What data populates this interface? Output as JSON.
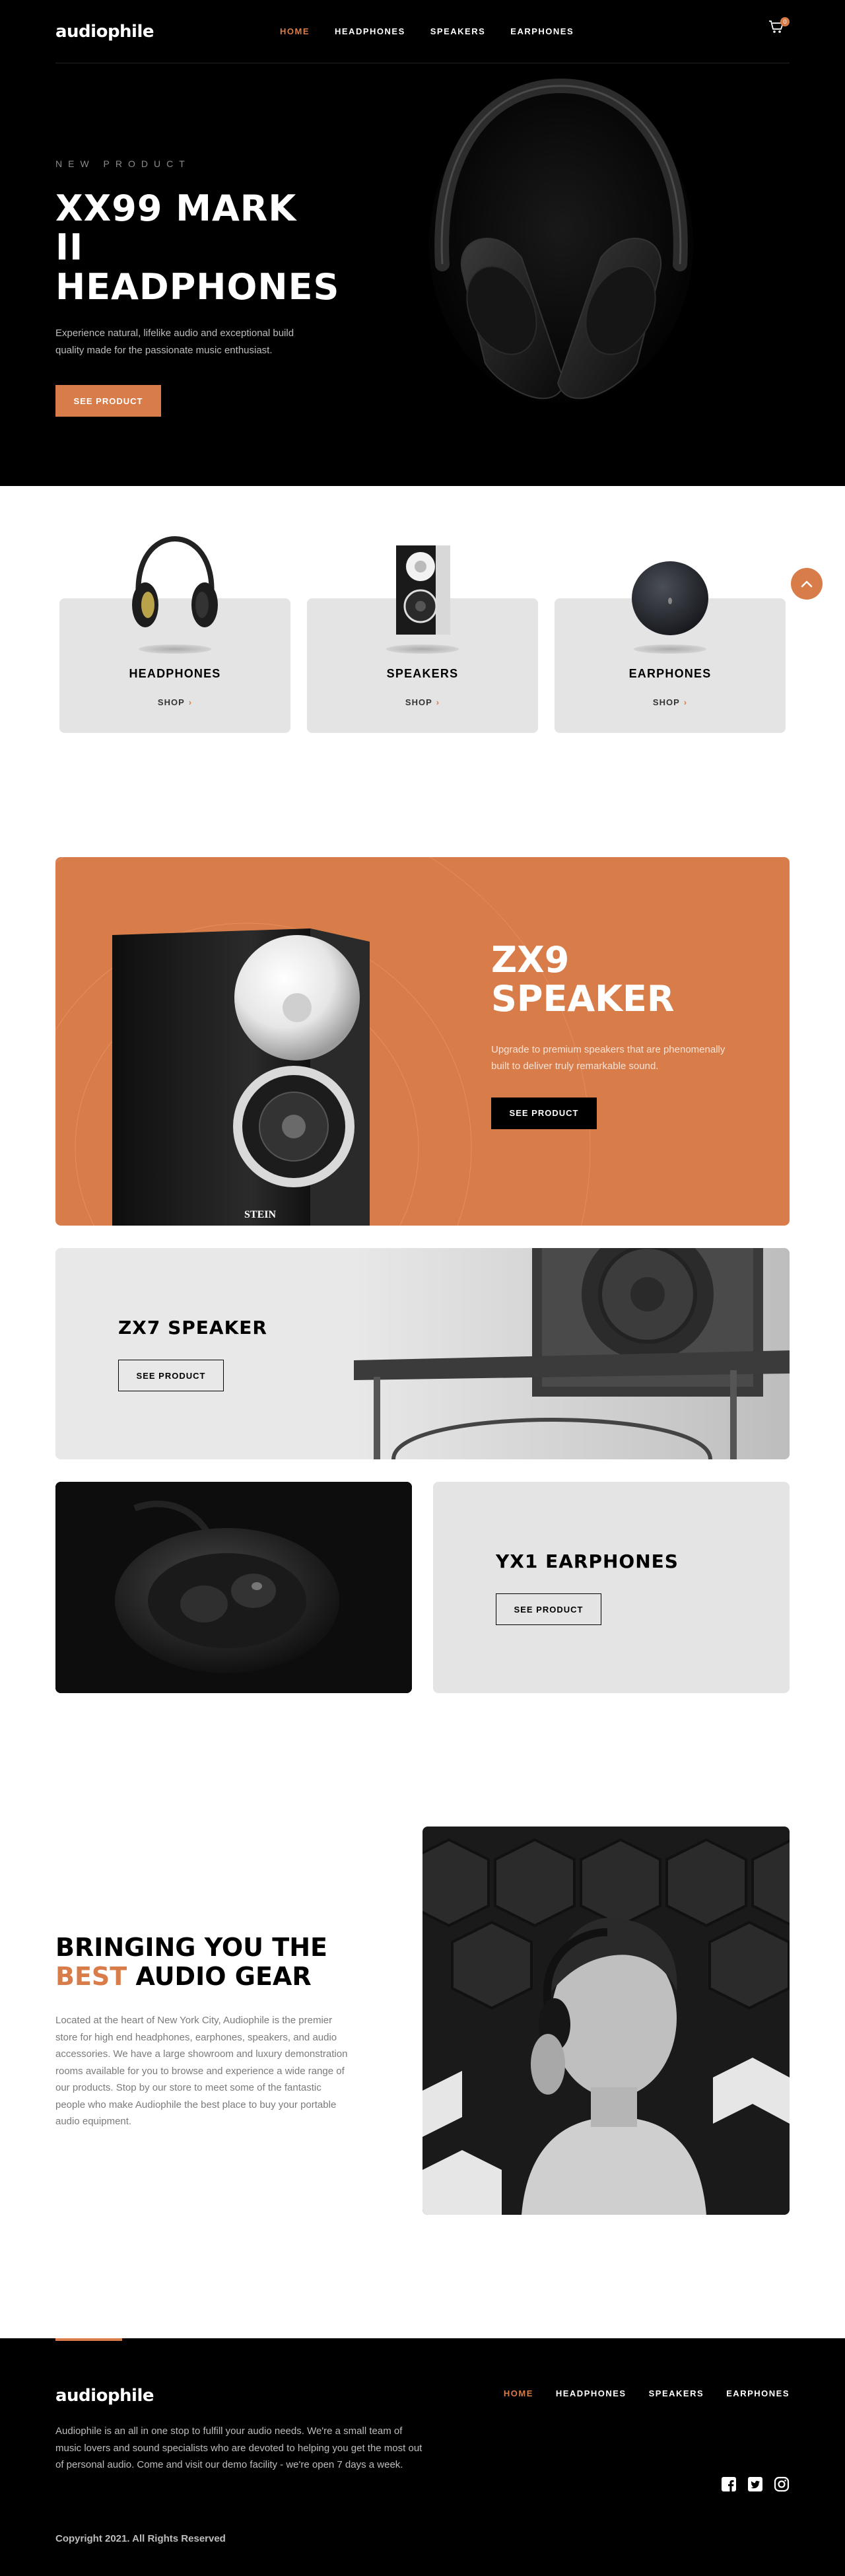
{
  "header": {
    "logo": "audiophile",
    "nav": [
      "HOME",
      "HEADPHONES",
      "SPEAKERS",
      "EARPHONES"
    ],
    "active_nav": "HOME",
    "cart_count": "0"
  },
  "hero": {
    "overline": "NEW PRODUCT",
    "title_line1": "XX99 MARK II",
    "title_line2": "HEADPHONES",
    "description": "Experience natural, lifelike audio and exceptional build quality made for the passionate music enthusiast.",
    "button": "SEE PRODUCT"
  },
  "categories": [
    {
      "title": "HEADPHONES",
      "link": "SHOP"
    },
    {
      "title": "SPEAKERS",
      "link": "SHOP"
    },
    {
      "title": "EARPHONES",
      "link": "SHOP"
    }
  ],
  "zx9": {
    "title_line1": "ZX9",
    "title_line2": "SPEAKER",
    "description": "Upgrade to premium speakers that are phenomenally built to deliver truly remarkable sound.",
    "button": "SEE PRODUCT",
    "brand": "STEIN"
  },
  "zx7": {
    "title": "ZX7 SPEAKER",
    "button": "SEE PRODUCT"
  },
  "yx1": {
    "title": "YX1 EARPHONES",
    "button": "SEE PRODUCT"
  },
  "about": {
    "title_part1": "BRINGING YOU THE",
    "title_accent": "BEST",
    "title_part2": "AUDIO GEAR",
    "description": "Located at the heart of New York City, Audiophile is the premier store for high end headphones, earphones, speakers, and audio accessories. We have a large showroom and luxury demonstration rooms available for you to browse and experience a wide range of our products. Stop by our store to meet some of the fantastic people who make Audiophile the best place to buy your portable audio equipment."
  },
  "footer": {
    "logo": "audiophile",
    "nav": [
      "HOME",
      "HEADPHONES",
      "SPEAKERS",
      "EARPHONES"
    ],
    "description": "Audiophile is an all in one stop to fulfill your audio needs. We're a small team of music lovers and sound specialists who are devoted to helping you get the most out of personal audio. Come and visit our demo facility - we're open 7 days a week.",
    "copyright": "Copyright 2021. All Rights Reserved",
    "socials": [
      "facebook-icon",
      "twitter-icon",
      "instagram-icon"
    ]
  },
  "colors": {
    "accent": "#d87d4a",
    "dark": "#000000",
    "light_gray": "#f1f1f1"
  }
}
